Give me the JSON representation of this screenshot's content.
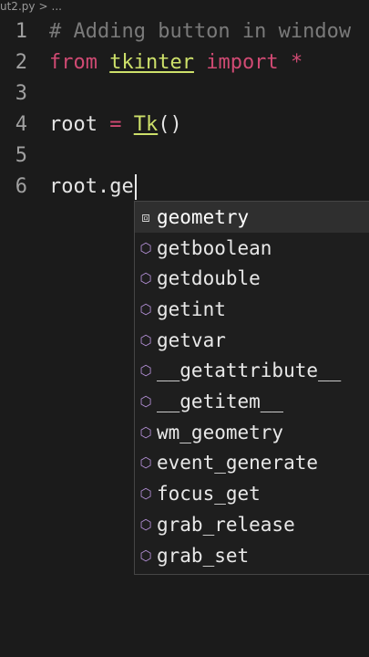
{
  "breadcrumb": {
    "file": "ut2.py",
    "sep": ">",
    "more": "..."
  },
  "lines": [
    {
      "num": "1",
      "comment": "# Adding button in window"
    },
    {
      "num": "2",
      "kw_from": "from",
      "module": "tkinter",
      "kw_import": "import",
      "star": "*"
    },
    {
      "num": "3"
    },
    {
      "num": "4",
      "var": "root",
      "op": "=",
      "fn": "Tk",
      "parens": "()"
    },
    {
      "num": "5"
    },
    {
      "num": "6",
      "text": "root.ge"
    }
  ],
  "suggestions": [
    {
      "label": "geometry",
      "icon": "method-box-icon",
      "selected": true
    },
    {
      "label": "getboolean",
      "icon": "method-cube-icon"
    },
    {
      "label": "getdouble",
      "icon": "method-cube-icon"
    },
    {
      "label": "getint",
      "icon": "method-cube-icon"
    },
    {
      "label": "getvar",
      "icon": "method-cube-icon"
    },
    {
      "label": "__getattribute__",
      "icon": "method-cube-icon"
    },
    {
      "label": "__getitem__",
      "icon": "method-cube-icon"
    },
    {
      "label": "wm_geometry",
      "icon": "method-cube-icon"
    },
    {
      "label": "event_generate",
      "icon": "method-cube-icon"
    },
    {
      "label": "focus_get",
      "icon": "method-cube-icon"
    },
    {
      "label": "grab_release",
      "icon": "method-cube-icon"
    },
    {
      "label": "grab_set",
      "icon": "method-cube-icon"
    }
  ],
  "colors": {
    "background": "#1b1b1b",
    "keyword": "#d04a73",
    "module": "#cde06a",
    "comment": "#7a7a7a",
    "icon": "#b38fd6"
  }
}
